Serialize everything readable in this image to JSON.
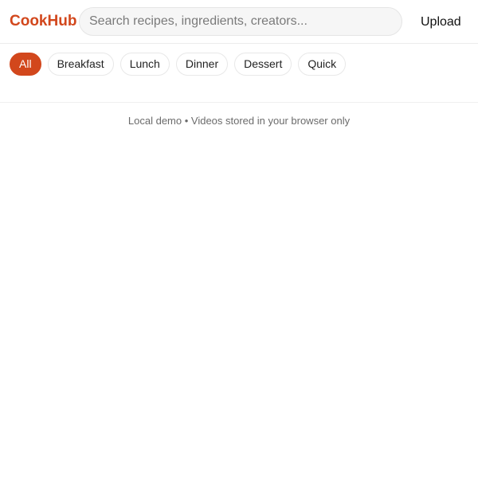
{
  "brand": {
    "name": "CookHub",
    "accent_color": "#d2471c"
  },
  "search": {
    "placeholder": "Search recipes, ingredients, creators...",
    "value": "",
    "icon": "none"
  },
  "header": {
    "upload_label": "Upload"
  },
  "categories": {
    "selected": "All",
    "items": [
      {
        "label": "All"
      },
      {
        "label": "Breakfast"
      },
      {
        "label": "Lunch"
      },
      {
        "label": "Dinner"
      },
      {
        "label": "Dessert"
      },
      {
        "label": "Quick"
      }
    ]
  },
  "footer_note": {
    "text": "Local demo • Videos stored in your browser only"
  }
}
